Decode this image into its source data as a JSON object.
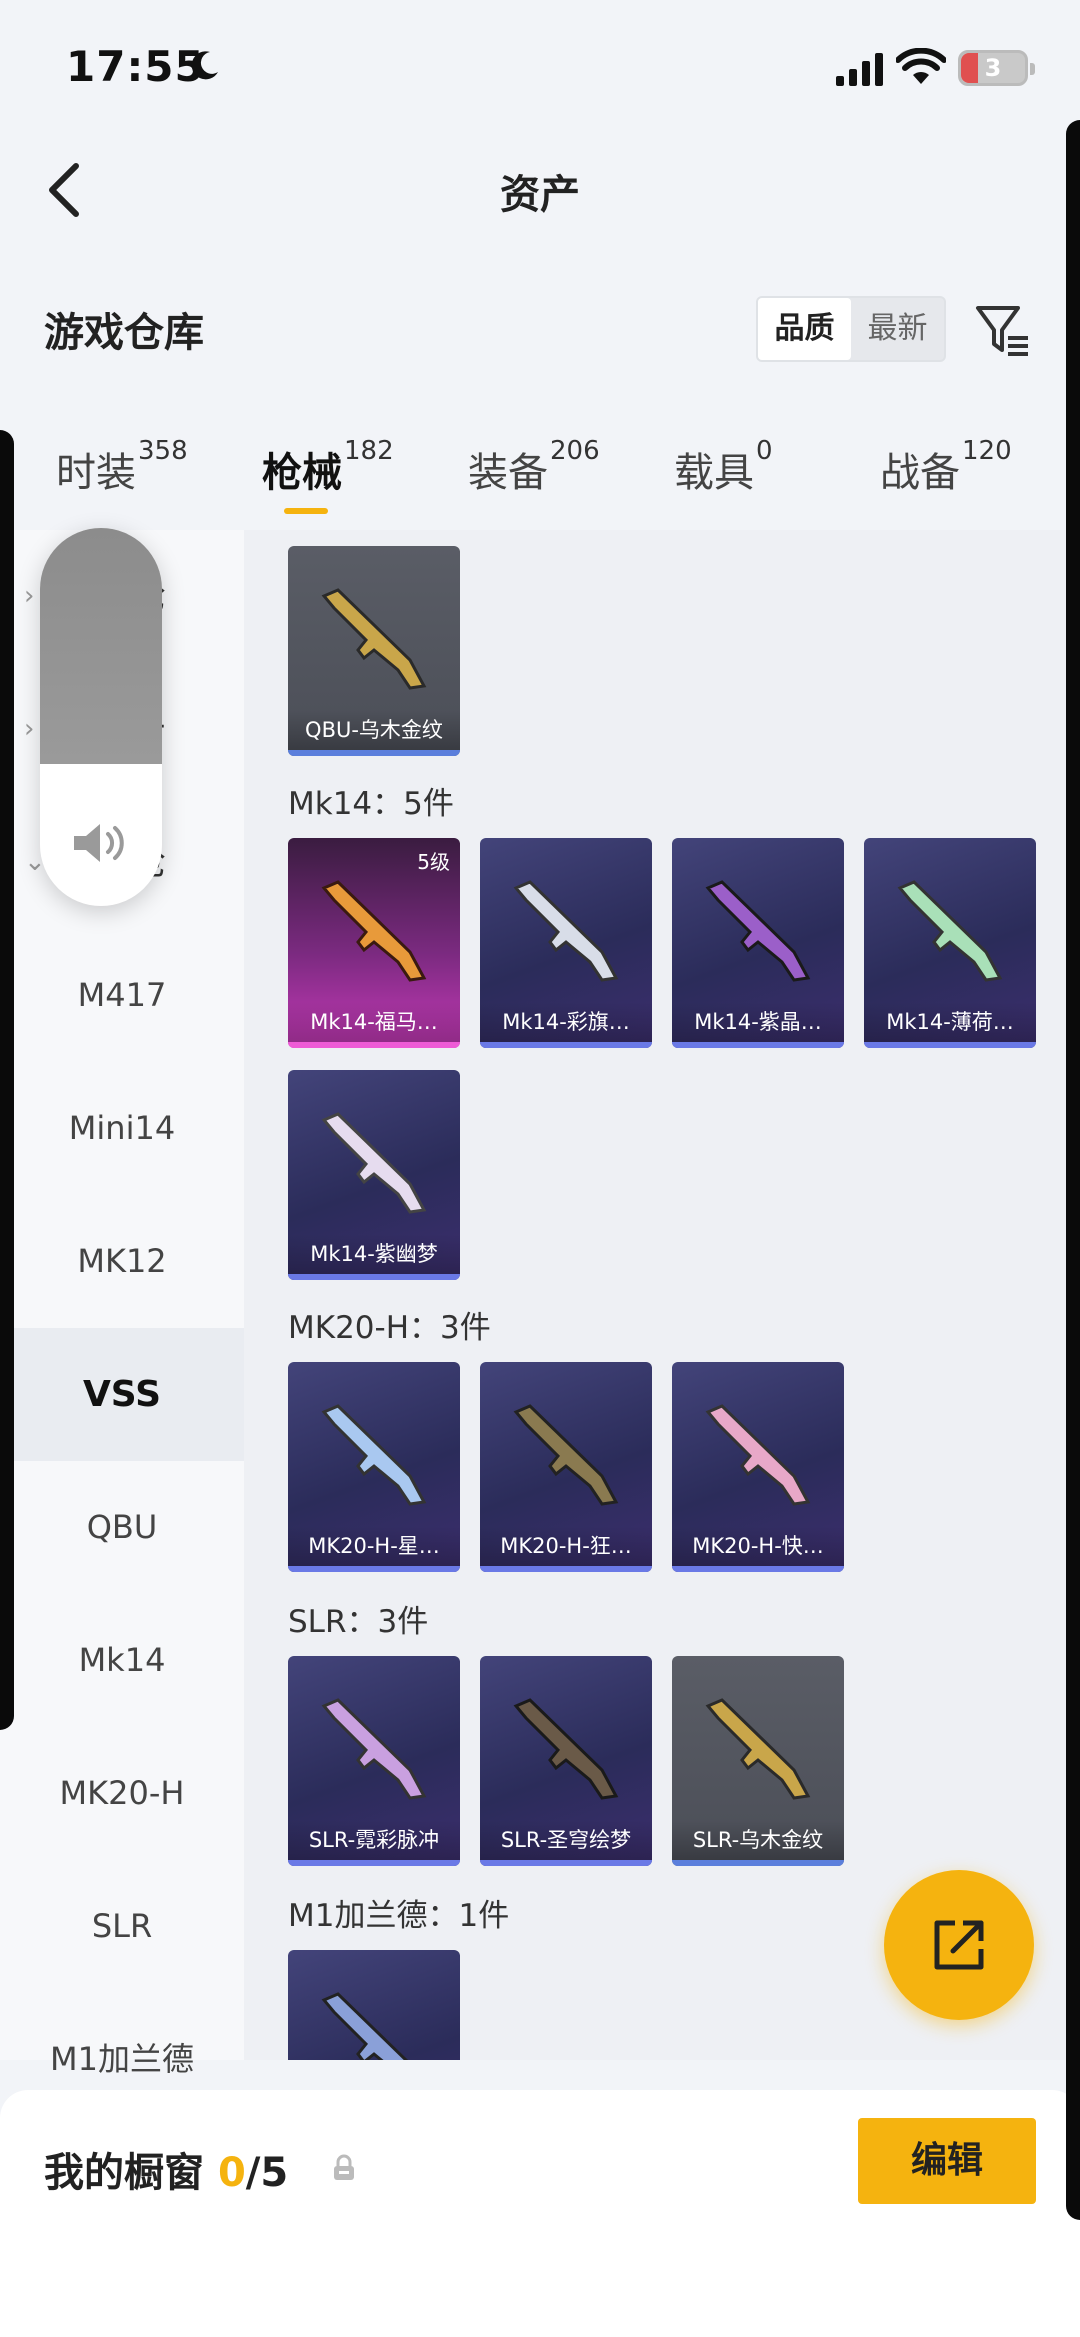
{
  "status_bar": {
    "time": "17:55",
    "battery": "3"
  },
  "header": {
    "title": "资产"
  },
  "warehouse": {
    "title": "游戏仓库",
    "sort_options": [
      "品质",
      "最新"
    ]
  },
  "tabs": [
    {
      "label": "时装",
      "count": "358"
    },
    {
      "label": "枪械",
      "count": "182"
    },
    {
      "label": "装备",
      "count": "206"
    },
    {
      "label": "载具",
      "count": "0"
    },
    {
      "label": "战备",
      "count": "120"
    }
  ],
  "sidebar": {
    "partial": [
      "枪",
      "击",
      "枪"
    ],
    "items": [
      "M417",
      "Mini14",
      "MK12",
      "VSS",
      "QBU",
      "Mk14",
      "MK20-H",
      "SLR",
      "M1加兰德"
    ]
  },
  "groups": {
    "qbu": {
      "cards": [
        {
          "label": "QBU-乌木金纹"
        }
      ]
    },
    "mk14": {
      "label": "Mk14：5件",
      "cards": [
        {
          "label": "Mk14-福马…",
          "level": "5级"
        },
        {
          "label": "Mk14-彩旗…"
        },
        {
          "label": "Mk14-紫晶…"
        },
        {
          "label": "Mk14-薄荷…"
        },
        {
          "label": "Mk14-紫幽梦"
        }
      ]
    },
    "mk20": {
      "label": "MK20-H：3件",
      "cards": [
        {
          "label": "MK20-H-星…"
        },
        {
          "label": "MK20-H-狂…"
        },
        {
          "label": "MK20-H-快…"
        }
      ]
    },
    "slr": {
      "label": "SLR：3件",
      "cards": [
        {
          "label": "SLR-霓彩脉冲"
        },
        {
          "label": "SLR-圣穹绘梦"
        },
        {
          "label": "SLR-乌木金纹"
        }
      ]
    },
    "m1": {
      "label": "M1加兰德：1件"
    }
  },
  "bottom": {
    "label": "我的橱窗",
    "used": "0",
    "total": "/5",
    "edit": "编辑"
  },
  "colors": {
    "accent": "#f5b30f",
    "card_purple": "#2b2c5a",
    "card_grey": "#4b4e57"
  },
  "icons": [
    "back-icon",
    "filter-icon",
    "moon-icon",
    "signal-icon",
    "wifi-icon",
    "speaker-icon",
    "share-icon",
    "lock-icon"
  ]
}
